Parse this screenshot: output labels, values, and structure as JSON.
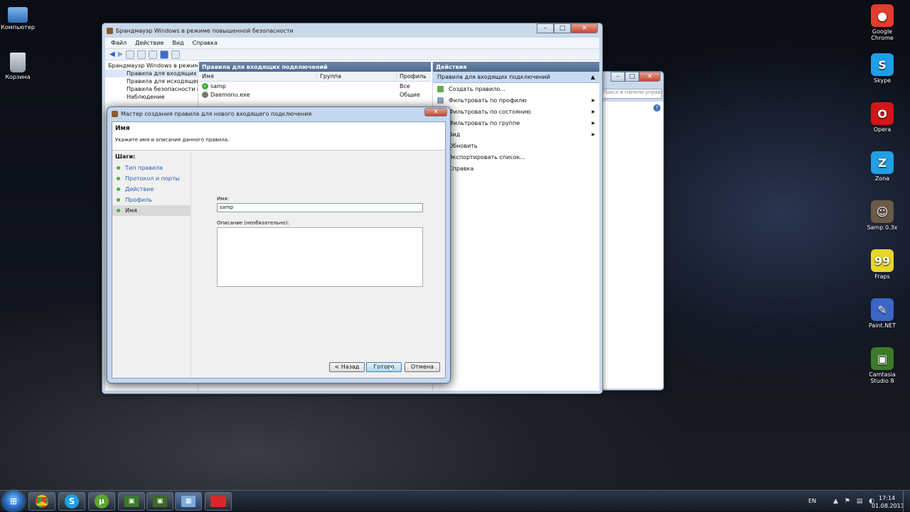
{
  "desktop": {
    "left_icons": [
      {
        "label": "Компьютер"
      },
      {
        "label": "Корзина"
      }
    ],
    "right_icons": [
      {
        "label": "Google Chrome",
        "glyph": "●",
        "color": "#e33b2e"
      },
      {
        "label": "Skype",
        "glyph": "S",
        "color": "#1d9ee6"
      },
      {
        "label": "Opera",
        "glyph": "O",
        "color": "#d41616"
      },
      {
        "label": "Zona",
        "glyph": "Z",
        "color": "#22a0e2"
      },
      {
        "label": "Samp 0.3x",
        "glyph": "☺",
        "color": "#6b5a48"
      },
      {
        "label": "Fraps",
        "glyph": "99",
        "color": "#e7d52a"
      },
      {
        "label": "Paint.NET",
        "glyph": "✎",
        "color": "#3b66c4"
      },
      {
        "label": "Camtasia Studio 8",
        "glyph": "▣",
        "color": "#3c7a2a"
      }
    ]
  },
  "firewall": {
    "title": "Брандмауэр Windows в режиме повышенной безопасности",
    "menu": [
      "Файл",
      "Действие",
      "Вид",
      "Справка"
    ],
    "tree": [
      "Брандмауэр Windows в режим",
      "Правила для входящих по",
      "Правила для исходящего",
      "Правила безопасности под",
      "Наблюдение"
    ],
    "center_header": "Правила для входящих подключений",
    "columns": [
      "Имя",
      "Группа",
      "Профиль"
    ],
    "rows": [
      {
        "name": "samp",
        "group": "",
        "profile": "Все"
      },
      {
        "name": "Daemonu.exe",
        "group": "",
        "profile": "Общие"
      }
    ],
    "actions_header": "Действия",
    "actions_section": "Правила для входящих подключений",
    "actions": [
      {
        "label": "Создать правило...",
        "arrow": ""
      },
      {
        "label": "Фильтровать по профилю",
        "arrow": "▶"
      },
      {
        "label": "Фильтровать по состоянию",
        "arrow": "▶"
      },
      {
        "label": "Фильтровать по группе",
        "arrow": "▶"
      },
      {
        "label": "Вид",
        "arrow": "▶"
      },
      {
        "label": "Обновить",
        "arrow": ""
      },
      {
        "label": "Экспортировать список...",
        "arrow": ""
      },
      {
        "label": "Справка",
        "arrow": ""
      }
    ]
  },
  "back_window": {
    "search_placeholder": "Поиск в панели управления"
  },
  "wizard": {
    "title": "Мастер создания правила для нового входящего подключения",
    "heading": "Имя",
    "subheading": "Укажите имя и описание данного правила.",
    "steps_label": "Шаги:",
    "steps": [
      "Тип правила",
      "Протокол и порты",
      "Действие",
      "Профиль",
      "Имя"
    ],
    "name_label": "Имя:",
    "name_value": "samp",
    "desc_label": "Описание (необязательно):",
    "desc_value": "",
    "back_button": "< Назад",
    "finish_button": "Готово",
    "cancel_button": "Отмена"
  },
  "taskbar": {
    "apps": [
      "chrome",
      "skype",
      "utorrent",
      "camtasia",
      "samp",
      "firewall",
      "media"
    ],
    "lang": "EN",
    "time": "17:14",
    "date": "01.08.2013"
  }
}
